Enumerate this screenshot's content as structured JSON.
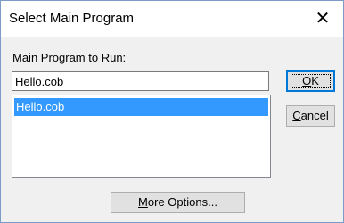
{
  "window": {
    "title": "Select Main Program",
    "close_glyph": "✕"
  },
  "form": {
    "label": "Main Program to Run:",
    "input_value": "Hello.cob",
    "list_items": [
      {
        "label": "Hello.cob",
        "selected": true
      }
    ]
  },
  "buttons": {
    "ok_mnemonic": "O",
    "ok_rest": "K",
    "cancel_mnemonic": "C",
    "cancel_rest": "ancel",
    "more_mnemonic": "M",
    "more_rest": "ore Options..."
  },
  "colors": {
    "selection": "#3399ff",
    "window_border": "#7a9cc6",
    "default_button_border": "#0078d7"
  },
  "icons": {
    "close": "close-icon"
  }
}
